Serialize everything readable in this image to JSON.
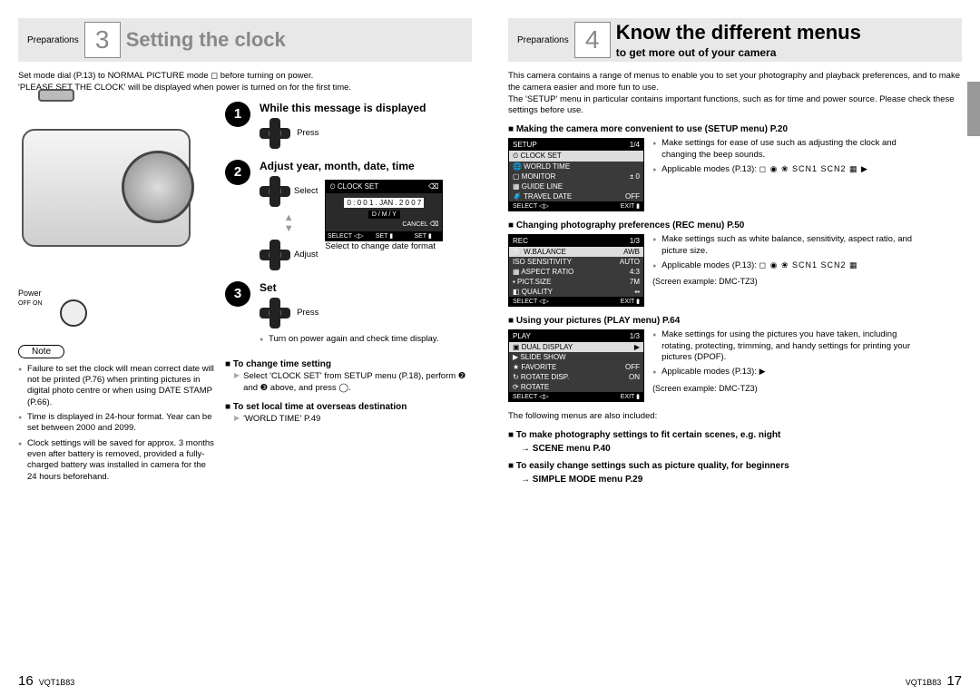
{
  "left": {
    "prep": "Preparations",
    "stepnum": "3",
    "title": "Setting the clock",
    "intro1": "Set mode dial (P.13) to NORMAL PICTURE mode ◻ before turning on power.",
    "intro2": "'PLEASE SET THE CLOCK' will be displayed when power is turned on for the first time.",
    "power": "Power",
    "offon": "OFF  ON",
    "s1": {
      "title": "While this message is displayed",
      "press": "Press"
    },
    "s2": {
      "title": "Adjust year, month, date, time",
      "select": "Select",
      "adjust": "Adjust",
      "hint1": "Select to change date format",
      "lcd": {
        "top": "⏲ CLOCK SET",
        "date": "0 : 0 0   1 . JAN . 2 0 0 7",
        "fmt": "D / M / Y",
        "cancel": "CANCEL ⌫",
        "b1": "SELECT ◁▷",
        "b2": "SET ▮",
        "b3": "SET ▮"
      }
    },
    "s3": {
      "title": "Set",
      "press": "Press",
      "note": "Turn on power again and check time display."
    },
    "change": {
      "h": "To change time setting",
      "t": "Select 'CLOCK SET' from SETUP menu (P.18), perform ❷ and ❸ above, and press ◯."
    },
    "overseas": {
      "h": "To set local time at overseas destination",
      "t": "'WORLD TIME' P.49"
    },
    "note_label": "Note",
    "notes": [
      "Failure to set the clock will mean correct date will not be printed (P.76) when printing pictures in digital photo centre or when using DATE STAMP (P.66).",
      "Time is displayed in 24-hour format. Year can be set between 2000 and 2099.",
      "Clock settings will be saved for approx. 3 months even after battery is removed, provided a fully-charged battery was installed in camera for the 24 hours beforehand."
    ],
    "pg": "16",
    "doc": "VQT1B83"
  },
  "right": {
    "prep": "Preparations",
    "stepnum": "4",
    "title": "Know the different menus",
    "subtitle": "to get more out of your camera",
    "intro": "This camera contains a range of menus to enable you to set your photography and playback preferences, and to make the camera easier and more fun to use.\nThe 'SETUP' menu in particular contains important functions, such as for time and power source. Please check these settings before use.",
    "setup": {
      "h": "Making the camera more convenient to use (SETUP menu)",
      "pref": "P.20",
      "b1": "Make settings for ease of use such as adjusting the clock and changing the beep sounds.",
      "b2": "Applicable modes (P.13):",
      "modes": "◻ ◉ ❀ SCN1 SCN2 ▦ ▶",
      "lcd": {
        "hdr": "SETUP",
        "pg": "1/4",
        "r1": [
          "⏲ CLOCK SET",
          ""
        ],
        "r2": [
          "🌐 WORLD TIME",
          ""
        ],
        "r3": [
          "▢ MONITOR",
          "± 0"
        ],
        "r4": [
          "▦ GUIDE LINE",
          ""
        ],
        "r5": [
          "🧳 TRAVEL DATE",
          "OFF"
        ],
        "f1": "SELECT ◁▷",
        "f2": "EXIT ▮"
      }
    },
    "rec": {
      "h": "Changing photography preferences (REC menu)",
      "pref": "P.50",
      "b1": "Make settings such as white balance, sensitivity, aspect ratio, and picture size.",
      "b2": "Applicable modes (P.13):",
      "modes": "◻ ◉ ❀ SCN1 SCN2 ▦",
      "ex": "(Screen example: DMC-TZ3)",
      "lcd": {
        "hdr": "REC",
        "pg": "1/3",
        "r1": [
          "⚪ W.BALANCE",
          "AWB"
        ],
        "r2": [
          "ISO SENSITIVITY",
          "AUTO"
        ],
        "r3": [
          "▦ ASPECT RATIO",
          "4:3"
        ],
        "r4": [
          "▪ PICT.SIZE",
          "7M"
        ],
        "r5": [
          "◧ QUALITY",
          "▪▪"
        ],
        "f1": "SELECT ◁▷",
        "f2": "EXIT ▮"
      }
    },
    "play": {
      "h": "Using your pictures (PLAY menu)",
      "pref": "P.64",
      "b1": "Make settings for using the pictures you have taken, including rotating, protecting, trimming, and handy settings for printing your pictures (DPOF).",
      "b2": "Applicable modes (P.13):",
      "modes": "▶",
      "ex": "(Screen example: DMC-TZ3)",
      "lcd": {
        "hdr": "PLAY",
        "pg": "1/3",
        "r1": [
          "▣ DUAL DISPLAY",
          "▶"
        ],
        "r2": [
          "▶ SLIDE SHOW",
          ""
        ],
        "r3": [
          "★ FAVORITE",
          "OFF"
        ],
        "r4": [
          "↻ ROTATE DISP.",
          "ON"
        ],
        "r5": [
          "⟳ ROTATE",
          ""
        ],
        "f1": "SELECT ◁▷",
        "f2": "EXIT ▮"
      }
    },
    "also": "The following menus are also included:",
    "scene": {
      "h": "To make photography settings to fit certain scenes, e.g. night",
      "t": "→ SCENE menu P.40"
    },
    "simple": {
      "h": "To easily change settings such as picture quality, for beginners",
      "t": "→ SIMPLE MODE menu P.29"
    },
    "pg": "17",
    "doc": "VQT1B83"
  }
}
